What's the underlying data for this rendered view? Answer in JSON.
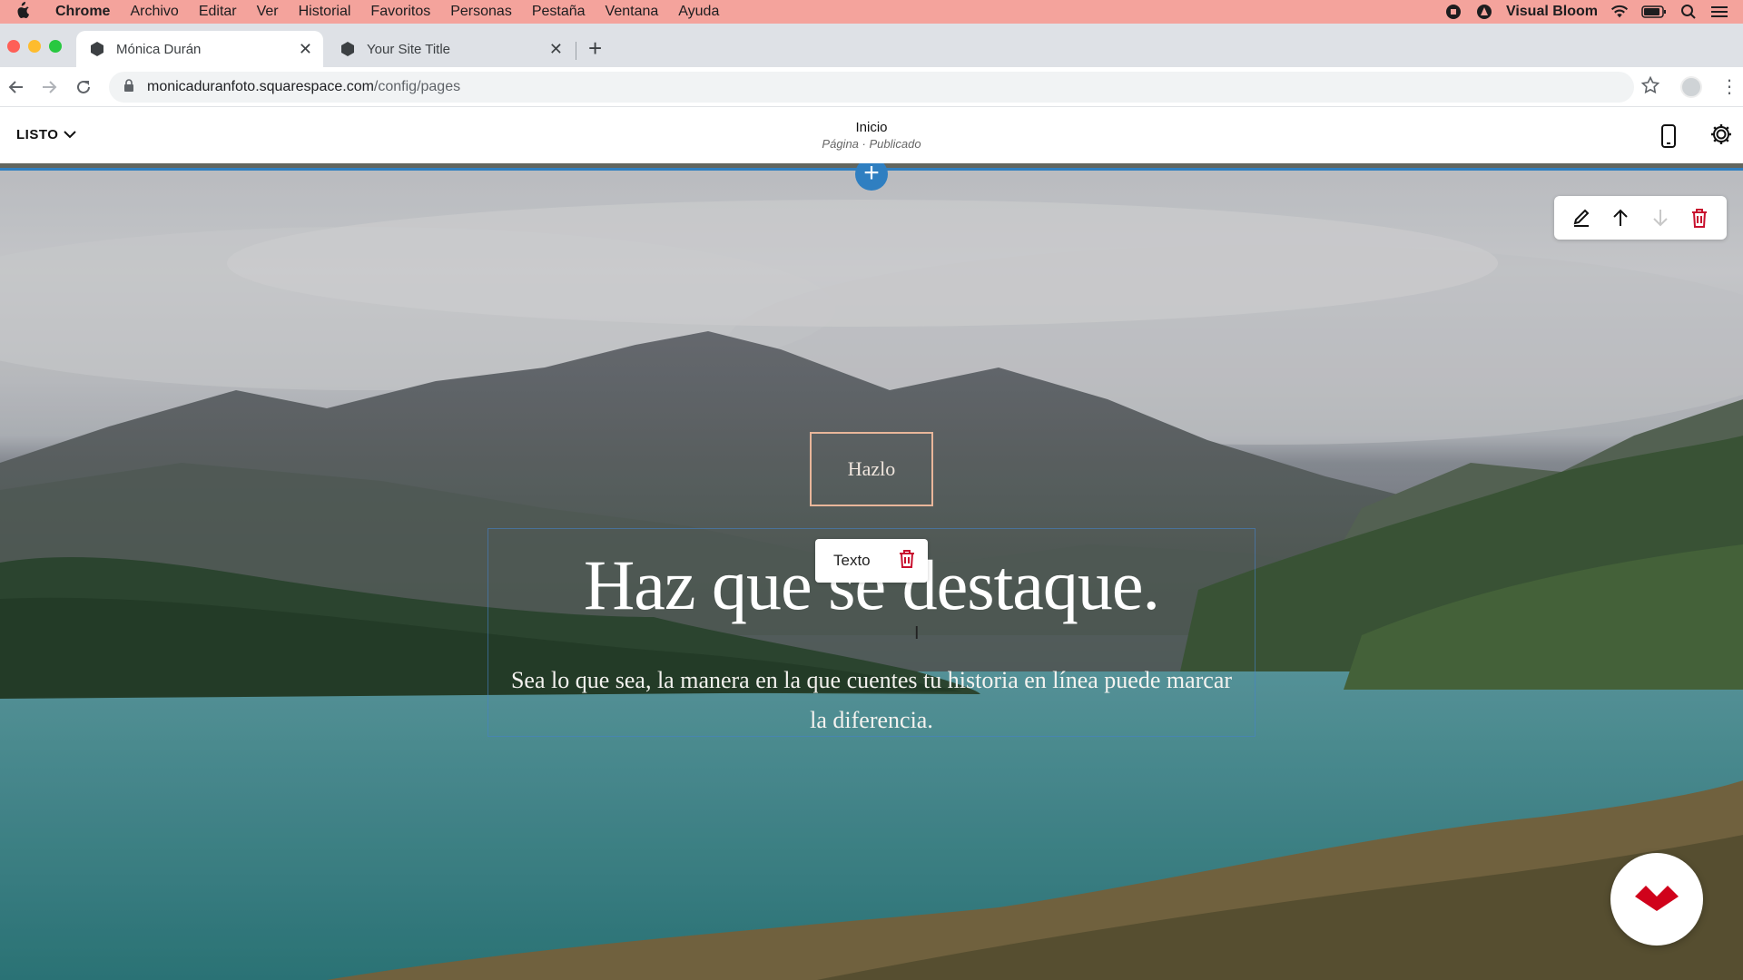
{
  "menubar": {
    "app": "Chrome",
    "items": [
      "Archivo",
      "Editar",
      "Ver",
      "Historial",
      "Favoritos",
      "Personas",
      "Pestaña",
      "Ventana",
      "Ayuda"
    ],
    "user": "Visual Bloom"
  },
  "tabs": [
    {
      "title": "Mónica Durán",
      "active": true
    },
    {
      "title": "Your Site Title",
      "active": false
    }
  ],
  "address": {
    "host": "monicaduranfoto.squarespace.com",
    "path": "/config/pages"
  },
  "editor": {
    "done_label": "LISTO",
    "page_title": "Inicio",
    "page_subtitle": "Página · Publicado"
  },
  "hero": {
    "button_label": "Hazlo",
    "popover_label": "Texto",
    "headline": "Haz que se destaque.",
    "body": "Sea lo que sea, la manera en la que cuentes tu historia en línea puede marcar la diferencia."
  },
  "colors": {
    "menubar": "#f4a39c",
    "accent_blue": "#2f7fc1",
    "trash_red": "#c8102e",
    "logo_red": "#d0021b"
  },
  "icons": [
    "apple-icon",
    "record-icon",
    "user-badge-icon",
    "wifi-icon",
    "battery-icon",
    "search-icon",
    "control-center-icon",
    "back-icon",
    "forward-icon",
    "reload-icon",
    "lock-icon",
    "star-icon",
    "profile-icon",
    "more-icon",
    "chevron-down-icon",
    "mobile-icon",
    "gear-icon",
    "plus-icon",
    "pencil-icon",
    "arrow-up-icon",
    "arrow-down-icon",
    "trash-icon",
    "text-cursor-icon",
    "logo-icon"
  ]
}
